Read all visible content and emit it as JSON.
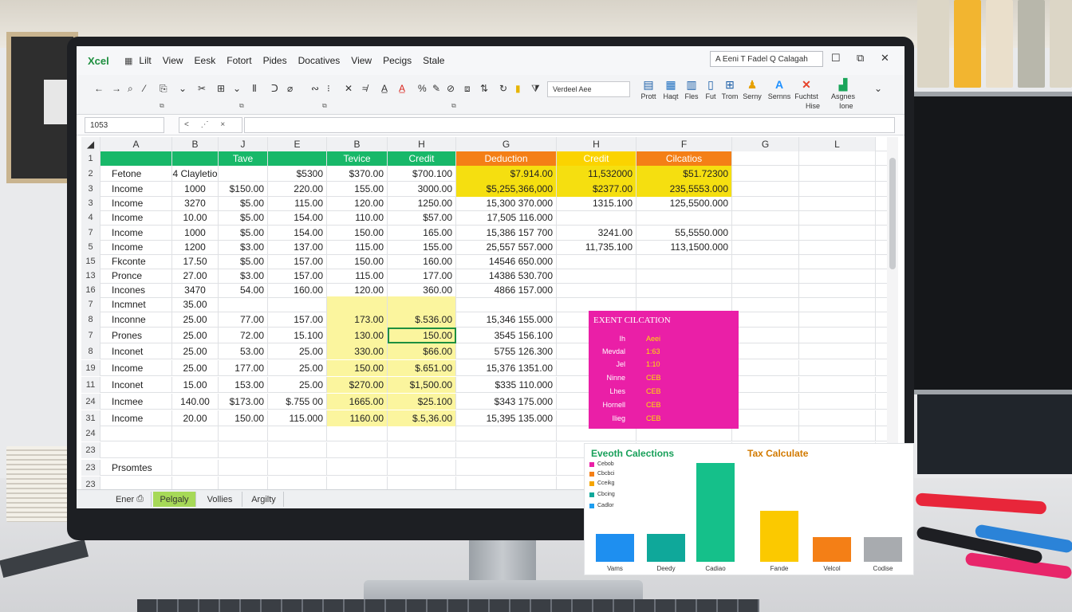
{
  "app": {
    "name": "Xcel"
  },
  "menu": [
    "Lilt",
    "View",
    "Eesk",
    "Fotort",
    "Pides",
    "Docatives",
    "View",
    "Pecigs",
    "Stale"
  ],
  "search": {
    "value": "A Eeni T Fadel Q Calagah"
  },
  "ribbon": {
    "font_box": "Verdeel Aee",
    "big_buttons": [
      {
        "label": "Prott",
        "icon": "print-icon"
      },
      {
        "label": "Haqt",
        "icon": "table-icon"
      },
      {
        "label": "Fles",
        "icon": "files-icon"
      },
      {
        "label": "Fut",
        "icon": "document-icon"
      },
      {
        "label": "Trom",
        "icon": "grid-icon"
      },
      {
        "label": "Serny",
        "icon": "people-icon"
      },
      {
        "label": "Sernns",
        "icon": "font-a-icon"
      },
      {
        "label": "Fuchtst",
        "icon": "x-function-icon"
      },
      {
        "label": "Asgnes",
        "icon": "chart-icon"
      }
    ],
    "big_sublabels": [
      "Hise",
      "Ione"
    ]
  },
  "formula_bar": {
    "name_box": "1053",
    "fx": "< ⋰ ×"
  },
  "sheet": {
    "column_headers": [
      "A",
      "B",
      "J",
      "E",
      "B",
      "H",
      "G",
      "H",
      "F",
      "G",
      "L"
    ],
    "header_row": {
      "row": "1",
      "b5": "Tave",
      "b6": "Tevice",
      "b7": "Credit",
      "b8": "Deduction",
      "b9": "Credit",
      "b10": "Cilcatios"
    },
    "rows": [
      {
        "n": "2",
        "a": "Fetone",
        "b": "14 Clayletion",
        "j": "",
        "e": "$5300",
        "b2": "$370.00",
        "h": "$700.100",
        "g": "$7.914.00",
        "h2": "11,532000",
        "f": "$51.72300",
        "g2": "",
        "l": ""
      },
      {
        "n": "3",
        "a": "Income",
        "b": "1000",
        "j": "$150.00",
        "e": "220.00",
        "b2": "155.00",
        "h": "3000.00",
        "g": "$5,255,366,000",
        "h2": "$2377.00",
        "f": "235,5553.000",
        "g2": "",
        "l": ""
      },
      {
        "n": "3",
        "a": "Income",
        "b": "3270",
        "j": "$5.00",
        "e": "115.00",
        "b2": "120.00",
        "h": "1250.00",
        "g": "15,300 370.000",
        "h2": "1315.100",
        "f": "125,5500.000",
        "g2": "",
        "l": ""
      },
      {
        "n": "4",
        "a": "Income",
        "b": "10.00",
        "j": "$5.00",
        "e": "154.00",
        "b2": "110.00",
        "h": "$57.00",
        "g": "17,505 116.000",
        "h2": "",
        "f": "",
        "g2": "",
        "l": ""
      },
      {
        "n": "7",
        "a": "Income",
        "b": "1000",
        "j": "$5.00",
        "e": "154.00",
        "b2": "150.00",
        "h": "165.00",
        "g": "15,386 157 700",
        "h2": "3241.00",
        "f": "55,5550.000",
        "g2": "",
        "l": ""
      },
      {
        "n": "5",
        "a": "Income",
        "b": "1200",
        "j": "$3.00",
        "e": "137.00",
        "b2": "115.00",
        "h": "155.00",
        "g": "25,557 557.000",
        "h2": "11,735.100",
        "f": "113,1500.000",
        "g2": "",
        "l": ""
      },
      {
        "n": "15",
        "a": "Fkconte",
        "b": "17.50",
        "j": "$5.00",
        "e": "157.00",
        "b2": "150.00",
        "h": "160.00",
        "g": "14546 650.000",
        "h2": "",
        "f": "",
        "g2": "",
        "l": ""
      },
      {
        "n": "13",
        "a": "Proncе",
        "b": "27.00",
        "j": "$3.00",
        "e": "157.00",
        "b2": "115.00",
        "h": "177.00",
        "g": "14386 530.700",
        "h2": "",
        "f": "",
        "g2": "",
        "l": ""
      },
      {
        "n": "16",
        "a": "Incones",
        "b": "3470",
        "j": "54.00",
        "e": "160.00",
        "b2": "120.00",
        "h": "360.00",
        "g": "4866 157.000",
        "h2": "",
        "f": "",
        "g2": "",
        "l": ""
      },
      {
        "n": "7",
        "a": "Incmnet",
        "b": "35.00",
        "j": "",
        "e": "",
        "b2": "",
        "h": "",
        "g": "",
        "h2": "",
        "f": "",
        "g2": "",
        "l": ""
      },
      {
        "n": "8",
        "a": "Inconne",
        "b": "25.00",
        "j": "77.00",
        "e": "157.00",
        "b2": "173.00",
        "h": "$.536.00",
        "g": "15,346 155.000",
        "h2": "",
        "f": "",
        "g2": "",
        "l": ""
      },
      {
        "n": "7",
        "a": "Prones",
        "b": "25.00",
        "j": "72.00",
        "e": "15.100",
        "b2": "130.00",
        "h": "150.00",
        "g": "3545 156.100",
        "h2": "",
        "f": "",
        "g2": "",
        "l": ""
      },
      {
        "n": "8",
        "a": "Inconet",
        "b": "25.00",
        "j": "53.00",
        "e": "25.00",
        "b2": "330.00",
        "h": "$66.00",
        "g": "5755 126.300",
        "h2": "",
        "f": "",
        "g2": "",
        "l": ""
      },
      {
        "n": "19",
        "a": "Income",
        "b": "25.00",
        "j": "177.00",
        "e": "25.00",
        "b2": "150.00",
        "h": "$.651.00",
        "g": "15,376 1351.00",
        "h2": "",
        "f": "",
        "g2": "",
        "l": ""
      },
      {
        "n": "11",
        "a": "Inconet",
        "b": "15.00",
        "j": "153.00",
        "e": "25.00",
        "b2": "$270.00",
        "h": "$1,500.00",
        "g": "$335 110.000",
        "h2": "",
        "f": "",
        "g2": "",
        "l": ""
      },
      {
        "n": "24",
        "a": "Incmee",
        "b": "140.00",
        "j": "$173.00",
        "e": "$.755 00",
        "b2": "1665.00",
        "h": "$25.100",
        "g": "$343 175.000",
        "h2": "",
        "f": "",
        "g2": "",
        "l": ""
      },
      {
        "n": "31",
        "a": "Income",
        "b": "20.00",
        "j": "150.00",
        "e": "115.000",
        "b2": "1160.00",
        "h": "$.5,36.00",
        "g": "15,395 135.000",
        "h2": "",
        "f": "",
        "g2": "",
        "l": ""
      },
      {
        "n": "24",
        "a": "",
        "b": "",
        "j": "",
        "e": "",
        "b2": "",
        "h": "",
        "g": "",
        "h2": "",
        "f": "",
        "g2": "",
        "l": ""
      },
      {
        "n": "23",
        "a": "",
        "b": "",
        "j": "",
        "e": "",
        "b2": "",
        "h": "",
        "g": "",
        "h2": "",
        "f": "",
        "g2": "",
        "l": ""
      },
      {
        "n": "23",
        "a": "Prsomtes",
        "b": "",
        "j": "",
        "e": "",
        "b2": "",
        "h": "",
        "g": "",
        "h2": "",
        "f": "",
        "g2": "",
        "l": ""
      },
      {
        "n": "23",
        "a": "",
        "b": "",
        "j": "",
        "e": "",
        "b2": "",
        "h": "",
        "g": "",
        "h2": "",
        "f": "",
        "g2": "",
        "l": ""
      }
    ]
  },
  "magenta_panel": {
    "title": "EXENT CILCATION",
    "rows": [
      {
        "a": "Ih",
        "b": "Aeei"
      },
      {
        "a": "Mevdal",
        "b": "1:63"
      },
      {
        "a": "Jel",
        "b": "1:10"
      },
      {
        "a": "Ninne",
        "b": "CEB"
      },
      {
        "a": "Lhes",
        "b": "CEB"
      },
      {
        "a": "Hornell",
        "b": "CEB"
      },
      {
        "a": "Ilieg",
        "b": "CEB"
      }
    ]
  },
  "tabs": [
    "Ener",
    "Pelgaly",
    "Vollies",
    "Argilty"
  ],
  "chart_data": [
    {
      "type": "bar",
      "title": "Eveoth Calections",
      "legend": [
        {
          "name": "Cebob",
          "color": "#ea1fa7"
        },
        {
          "name": "Cbcbci",
          "color": "#f47f16"
        },
        {
          "name": "Cceikg",
          "color": "#f5a500"
        },
        {
          "name": "Cbcing",
          "color": "#0fa89a"
        },
        {
          "name": "Cadlor",
          "color": "#1e9ef0"
        }
      ],
      "categories": [
        "Vams",
        "Deedy",
        "Cadiao"
      ],
      "values": [
        28,
        28,
        100
      ],
      "colors": [
        "#1e8ff0",
        "#0fa89a",
        "#15c08a"
      ],
      "ylim": [
        0,
        100
      ]
    },
    {
      "type": "bar",
      "title": "Tax Calculate",
      "categories": [
        "Fande",
        "Velcol",
        "Codise"
      ],
      "values": [
        52,
        25,
        25
      ],
      "colors": [
        "#fbc900",
        "#f47f16",
        "#a8abaf"
      ],
      "ylim": [
        0,
        100
      ]
    }
  ],
  "colors": {
    "green": "#18b869",
    "orange": "#f47f16",
    "gold": "#fbd300",
    "magenta": "#ea1fa7",
    "yellow": "#f5df10"
  }
}
